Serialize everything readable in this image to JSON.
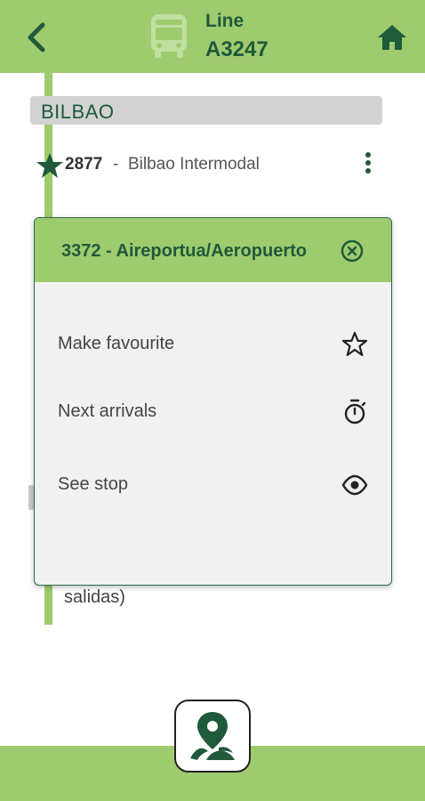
{
  "header": {
    "back_icon": "chevron-left-icon",
    "bus_icon": "bus-icon",
    "line_label": "Line",
    "line_code": "A3247",
    "home_icon": "home-icon"
  },
  "section": {
    "title": "BILBAO"
  },
  "stop": {
    "code": "2877",
    "separator": "-",
    "name": "Bilbao Intermodal",
    "favourite_icon": "star-filled-icon",
    "more_icon": "more-vertical-icon"
  },
  "partial_text": "salidas)",
  "dialog": {
    "title": "3372 - Aireportua/Aeropuerto",
    "close_icon": "close-circle-icon",
    "items": [
      {
        "label": "Make favourite",
        "icon": "star-outline-icon"
      },
      {
        "label": "Next arrivals",
        "icon": "stopwatch-icon"
      },
      {
        "label": "See stop",
        "icon": "eye-icon"
      }
    ]
  },
  "bottom": {
    "map_icon": "map-pin-icon"
  },
  "colors": {
    "accent_green": "#9fcb6f",
    "dark_green": "#1f5a3a",
    "dialog_bg": "#f1f1f1",
    "section_bg": "#d2d2d2"
  }
}
